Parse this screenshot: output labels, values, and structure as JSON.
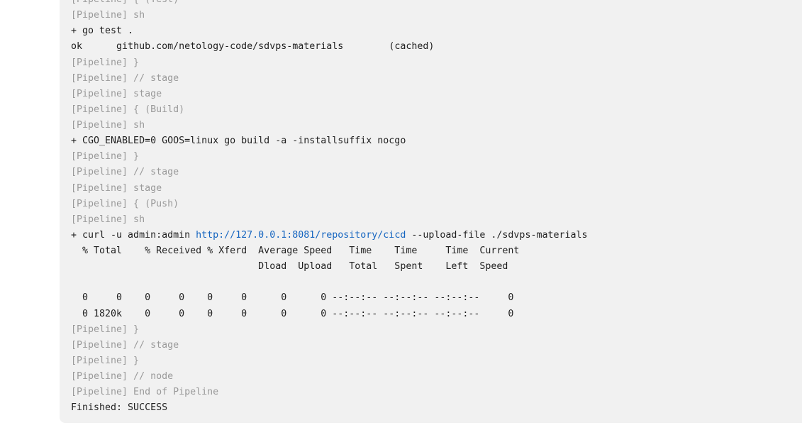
{
  "console": {
    "lines": [
      {
        "type": "pipeline",
        "text": "[Pipeline] { (Test)"
      },
      {
        "type": "pipeline",
        "text": "[Pipeline] sh"
      },
      {
        "type": "cmd",
        "text": "+ go test ."
      },
      {
        "type": "cmd",
        "text": "ok  \tgithub.com/netology-code/sdvps-materials\t(cached)"
      },
      {
        "type": "pipeline",
        "text": "[Pipeline] }"
      },
      {
        "type": "pipeline",
        "text": "[Pipeline] // stage"
      },
      {
        "type": "pipeline",
        "text": "[Pipeline] stage"
      },
      {
        "type": "pipeline",
        "text": "[Pipeline] { (Build)"
      },
      {
        "type": "pipeline",
        "text": "[Pipeline] sh"
      },
      {
        "type": "cmd",
        "text": "+ CGO_ENABLED=0 GOOS=linux go build -a -installsuffix nocgo"
      },
      {
        "type": "pipeline",
        "text": "[Pipeline] }"
      },
      {
        "type": "pipeline",
        "text": "[Pipeline] // stage"
      },
      {
        "type": "pipeline",
        "text": "[Pipeline] stage"
      },
      {
        "type": "pipeline",
        "text": "[Pipeline] { (Push)"
      },
      {
        "type": "pipeline",
        "text": "[Pipeline] sh"
      },
      {
        "type": "cmd-link",
        "before": "+ curl -u admin:admin ",
        "link": "http://127.0.0.1:8081/repository/cicd",
        "after": " --upload-file ./sdvps-materials"
      },
      {
        "type": "cmd",
        "text": "  % Total    % Received % Xferd  Average Speed   Time    Time     Time  Current"
      },
      {
        "type": "cmd",
        "text": "                                 Dload  Upload   Total   Spent    Left  Speed"
      },
      {
        "type": "cmd",
        "text": ""
      },
      {
        "type": "cmd",
        "text": "  0     0    0     0    0     0      0      0 --:--:-- --:--:-- --:--:--     0"
      },
      {
        "type": "cmd",
        "text": "  0 1820k    0     0    0     0      0      0 --:--:-- --:--:-- --:--:--     0"
      },
      {
        "type": "pipeline",
        "text": "[Pipeline] }"
      },
      {
        "type": "pipeline",
        "text": "[Pipeline] // stage"
      },
      {
        "type": "pipeline",
        "text": "[Pipeline] }"
      },
      {
        "type": "pipeline",
        "text": "[Pipeline] // node"
      },
      {
        "type": "pipeline",
        "text": "[Pipeline] End of Pipeline"
      },
      {
        "type": "cmd",
        "text": "Finished: SUCCESS"
      }
    ]
  }
}
